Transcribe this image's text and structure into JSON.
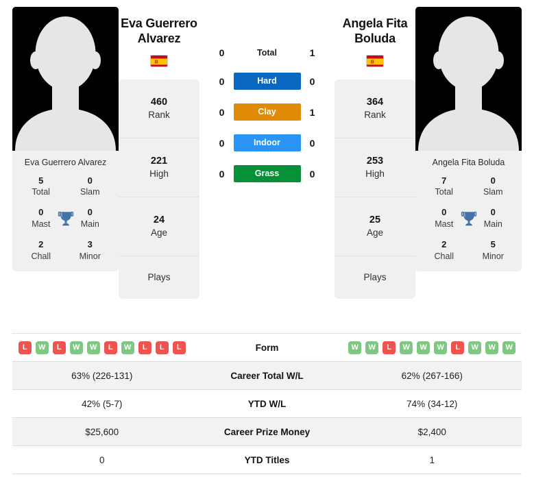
{
  "players": {
    "left": {
      "name": "Eva Guerrero Alvarez",
      "name_line1": "Eva Guerrero",
      "name_line2": "Alvarez",
      "flag": "spain-flag-icon",
      "rank": "460",
      "rank_label": "Rank",
      "high": "221",
      "high_label": "High",
      "age": "24",
      "age_label": "Age",
      "plays": "",
      "plays_label": "Plays",
      "titles": [
        {
          "value": "5",
          "label": "Total"
        },
        {
          "value": "0",
          "label": "Slam"
        },
        {
          "value": "0",
          "label": "Mast"
        },
        {
          "value": "0",
          "label": "Main"
        },
        {
          "value": "2",
          "label": "Chall"
        },
        {
          "value": "3",
          "label": "Minor"
        }
      ],
      "form": [
        "L",
        "W",
        "L",
        "W",
        "W",
        "L",
        "W",
        "L",
        "L",
        "L"
      ],
      "career_total_wl": "63% (226-131)",
      "ytd_wl": "42% (5-7)",
      "career_prize_money": "$25,600",
      "ytd_titles": "0"
    },
    "right": {
      "name": "Angela Fita Boluda",
      "name_line1": "Angela Fita",
      "name_line2": "Boluda",
      "flag": "spain-flag-icon",
      "rank": "364",
      "rank_label": "Rank",
      "high": "253",
      "high_label": "High",
      "age": "25",
      "age_label": "Age",
      "plays": "",
      "plays_label": "Plays",
      "titles": [
        {
          "value": "7",
          "label": "Total"
        },
        {
          "value": "0",
          "label": "Slam"
        },
        {
          "value": "0",
          "label": "Mast"
        },
        {
          "value": "0",
          "label": "Main"
        },
        {
          "value": "2",
          "label": "Chall"
        },
        {
          "value": "5",
          "label": "Minor"
        }
      ],
      "form": [
        "W",
        "W",
        "L",
        "W",
        "W",
        "W",
        "L",
        "W",
        "W",
        "W"
      ],
      "career_total_wl": "62% (267-166)",
      "ytd_wl": "74% (34-12)",
      "career_prize_money": "$2,400",
      "ytd_titles": "1"
    }
  },
  "head_to_head": {
    "total": {
      "label": "Total",
      "left": "0",
      "right": "1"
    },
    "surfaces": [
      {
        "label": "Hard",
        "left": "0",
        "right": "0",
        "color": "#0a67bf"
      },
      {
        "label": "Clay",
        "left": "0",
        "right": "1",
        "color": "#e08b05"
      },
      {
        "label": "Indoor",
        "left": "0",
        "right": "0",
        "color": "#2b95f5"
      },
      {
        "label": "Grass",
        "left": "0",
        "right": "0",
        "color": "#069138"
      }
    ]
  },
  "table": {
    "rows": [
      {
        "label": "Form"
      },
      {
        "label": "Career Total W/L"
      },
      {
        "label": "YTD W/L"
      },
      {
        "label": "Career Prize Money"
      },
      {
        "label": "YTD Titles"
      }
    ]
  },
  "colors": {
    "win": "#81c784",
    "loss": "#ef5350",
    "card_bg": "#f0f0f0",
    "trophy": "#4472a8",
    "row_alt": "#f2f2f2"
  }
}
